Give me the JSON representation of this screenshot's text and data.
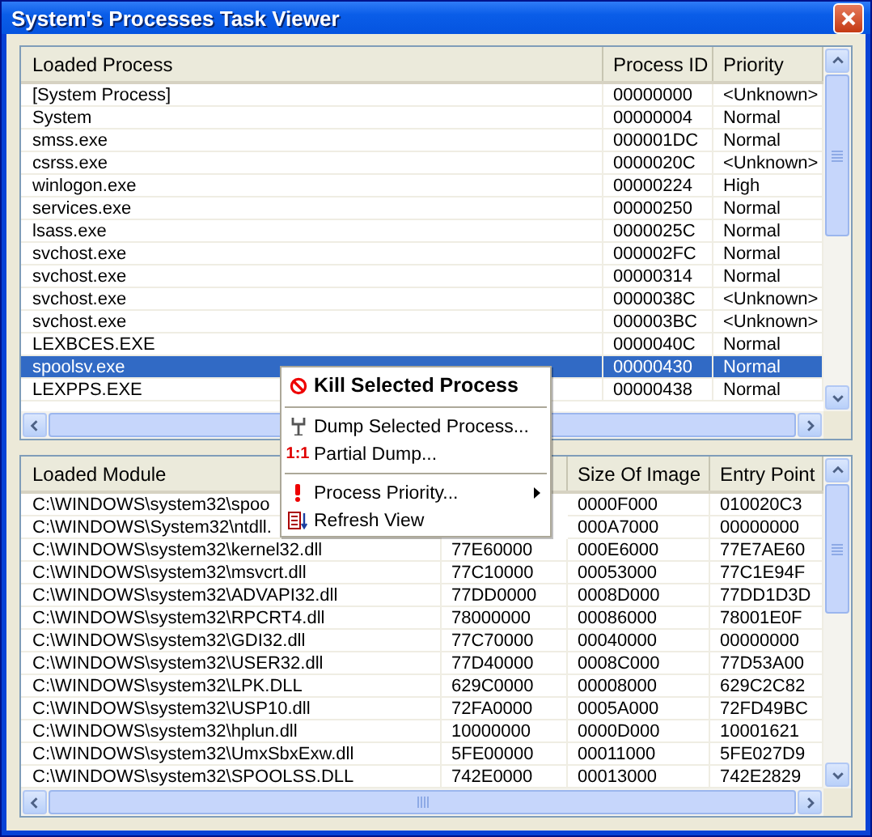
{
  "window": {
    "title": "System's Processes Task Viewer"
  },
  "process_table": {
    "columns": [
      "Loaded Process",
      "Process ID",
      "Priority"
    ],
    "rows": [
      {
        "name": "[System Process]",
        "pid": "00000000",
        "priority": "<Unknown>",
        "selected": false
      },
      {
        "name": "System",
        "pid": "00000004",
        "priority": "Normal",
        "selected": false
      },
      {
        "name": "smss.exe",
        "pid": "000001DC",
        "priority": "Normal",
        "selected": false
      },
      {
        "name": "csrss.exe",
        "pid": "0000020C",
        "priority": "<Unknown>",
        "selected": false
      },
      {
        "name": "winlogon.exe",
        "pid": "00000224",
        "priority": "High",
        "selected": false
      },
      {
        "name": "services.exe",
        "pid": "00000250",
        "priority": "Normal",
        "selected": false
      },
      {
        "name": "lsass.exe",
        "pid": "0000025C",
        "priority": "Normal",
        "selected": false
      },
      {
        "name": "svchost.exe",
        "pid": "000002FC",
        "priority": "Normal",
        "selected": false
      },
      {
        "name": "svchost.exe",
        "pid": "00000314",
        "priority": "Normal",
        "selected": false
      },
      {
        "name": "svchost.exe",
        "pid": "0000038C",
        "priority": "<Unknown>",
        "selected": false
      },
      {
        "name": "svchost.exe",
        "pid": "000003BC",
        "priority": "<Unknown>",
        "selected": false
      },
      {
        "name": "LEXBCES.EXE",
        "pid": "0000040C",
        "priority": "Normal",
        "selected": false
      },
      {
        "name": "spoolsv.exe",
        "pid": "00000430",
        "priority": "Normal",
        "selected": true
      },
      {
        "name": "LEXPPS.EXE",
        "pid": "00000438",
        "priority": "Normal",
        "selected": false
      }
    ]
  },
  "module_table": {
    "columns": [
      "Loaded Module",
      null,
      "Size Of Image",
      "Entry Point"
    ],
    "rows": [
      {
        "path": "C:\\WINDOWS\\system32\\spoo",
        "size": "0000F000",
        "entry": "010020C3"
      },
      {
        "path": "C:\\WINDOWS\\System32\\ntdll.",
        "size": "000A7000",
        "entry": "00000000"
      },
      {
        "path": "C:\\WINDOWS\\system32\\kernel32.dll",
        "base": "77E60000",
        "size": "000E6000",
        "entry": "77E7AE60"
      },
      {
        "path": "C:\\WINDOWS\\system32\\msvcrt.dll",
        "base": "77C10000",
        "size": "00053000",
        "entry": "77C1E94F"
      },
      {
        "path": "C:\\WINDOWS\\system32\\ADVAPI32.dll",
        "base": "77DD0000",
        "size": "0008D000",
        "entry": "77DD1D3D"
      },
      {
        "path": "C:\\WINDOWS\\system32\\RPCRT4.dll",
        "base": "78000000",
        "size": "00086000",
        "entry": "78001E0F"
      },
      {
        "path": "C:\\WINDOWS\\system32\\GDI32.dll",
        "base": "77C70000",
        "size": "00040000",
        "entry": "00000000"
      },
      {
        "path": "C:\\WINDOWS\\system32\\USER32.dll",
        "base": "77D40000",
        "size": "0008C000",
        "entry": "77D53A00"
      },
      {
        "path": "C:\\WINDOWS\\system32\\LPK.DLL",
        "base": "629C0000",
        "size": "00008000",
        "entry": "629C2C82"
      },
      {
        "path": "C:\\WINDOWS\\system32\\USP10.dll",
        "base": "72FA0000",
        "size": "0005A000",
        "entry": "72FD49BC"
      },
      {
        "path": "C:\\WINDOWS\\system32\\hplun.dll",
        "base": "10000000",
        "size": "0000D000",
        "entry": "10001621"
      },
      {
        "path": "C:\\WINDOWS\\system32\\UmxSbxExw.dll",
        "base": "5FE00000",
        "size": "00011000",
        "entry": "5FE027D9"
      },
      {
        "path": "C:\\WINDOWS\\system32\\SPOOLSS.DLL",
        "base": "742E0000",
        "size": "00013000",
        "entry": "742E2829"
      }
    ]
  },
  "context_menu": {
    "items": [
      {
        "kind": "kill",
        "label": "Kill Selected Process",
        "bold": true,
        "submenu": false
      },
      {
        "kind": "separator"
      },
      {
        "kind": "dump",
        "label": "Dump Selected Process...",
        "bold": false,
        "submenu": false
      },
      {
        "kind": "partial",
        "label": "Partial Dump...",
        "icon_text": "1:1",
        "bold": false,
        "submenu": false
      },
      {
        "kind": "separator"
      },
      {
        "kind": "priority",
        "label": "Process Priority...",
        "bold": false,
        "submenu": true
      },
      {
        "kind": "refresh",
        "label": "Refresh View",
        "bold": false,
        "submenu": false
      }
    ]
  }
}
